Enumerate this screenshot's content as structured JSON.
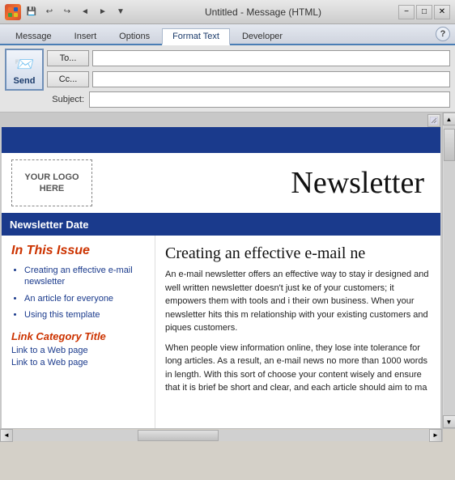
{
  "titlebar": {
    "title": "Untitled - Message (HTML)",
    "minimize": "−",
    "maximize": "□",
    "close": "✕"
  },
  "toolbar": {
    "save": "💾",
    "undo": "↩",
    "redo": "↪",
    "left": "◄",
    "right": "►",
    "dropdown": "▼"
  },
  "ribbon": {
    "tabs": [
      "Message",
      "Insert",
      "Options",
      "Format Text",
      "Developer"
    ],
    "active_tab": "Format Text",
    "help": "?"
  },
  "compose": {
    "to_label": "To...",
    "cc_label": "Cc...",
    "subject_label": "Subject:",
    "send_label": "Send",
    "to_value": "",
    "cc_value": "",
    "subject_value": ""
  },
  "newsletter": {
    "header_bar": "",
    "logo_text": "YOUR LOGO\nHERE",
    "title": "Newsletter",
    "date_bar_text": "Newsletter Date",
    "sidebar": {
      "section_title": "In This Issue",
      "items": [
        "Creating an effective e-mail newsletter",
        "An article for everyone",
        "Using this template"
      ],
      "link_title": "Link Category Title",
      "links": [
        "Link to a Web page",
        "Link to a Web page"
      ]
    },
    "article": {
      "title": "Creating an effective e-mail ne",
      "paragraphs": [
        "An e-mail newsletter offers an effective way to stay ir designed and well written newsletter doesn't just ke of your customers; it empowers them with tools and i their own business. When your newsletter hits this m relationship with your existing customers and piques customers.",
        "When people view information online, they lose inte tolerance for long articles. As a result, an e-mail news no more than 1000 words in length. With this sort of choose your content wisely and ensure that it is brief be short and clear, and each article should aim to ma"
      ]
    }
  },
  "scrollbars": {
    "v_up": "▲",
    "v_down": "▼",
    "h_left": "◄",
    "h_right": "►"
  }
}
